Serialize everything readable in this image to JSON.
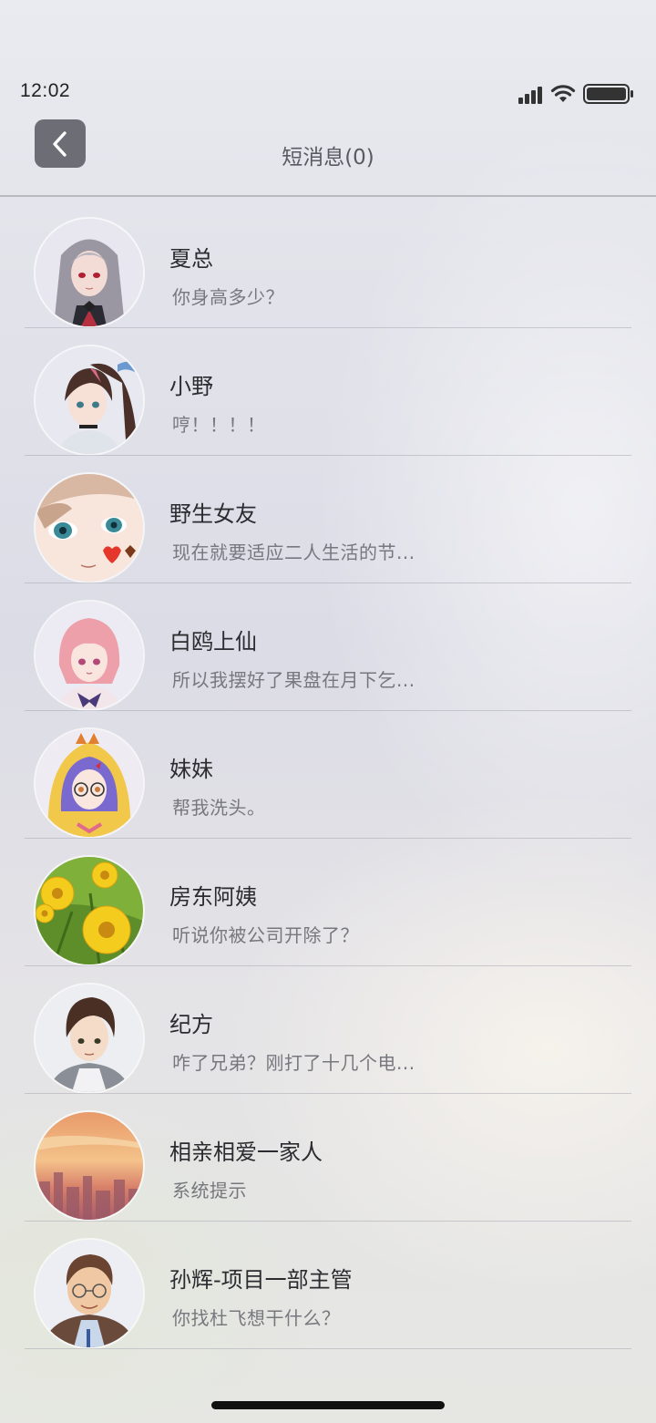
{
  "status_bar": {
    "time": "12:02"
  },
  "header": {
    "title": "短消息(0)",
    "back_icon": "chevron-left-icon"
  },
  "colors": {
    "back_button_bg": "#6d6d75",
    "title_text": "#5a5a62",
    "name_text": "#2b2b30",
    "preview_text": "#77777e"
  },
  "messages": [
    {
      "name": "夏总",
      "preview": "你身高多少？",
      "avatar": "anime-woman-silver-hair-avatar"
    },
    {
      "name": "小野",
      "preview": "哼！！！！",
      "avatar": "anime-girl-ponytail-avatar"
    },
    {
      "name": "野生女友",
      "preview": "现在就要适应二人生活的节...",
      "avatar": "anime-girl-closeup-heart-avatar"
    },
    {
      "name": "白鸥上仙",
      "preview": "所以我摆好了果盘在月下乞...",
      "avatar": "anime-girl-pink-hair-avatar"
    },
    {
      "name": "妹妹",
      "preview": "帮我洗头。",
      "avatar": "anime-girl-glasses-hood-avatar"
    },
    {
      "name": "房东阿姨",
      "preview": "听说你被公司开除了？",
      "avatar": "yellow-flowers-avatar"
    },
    {
      "name": "纪方",
      "preview": "咋了兄弟？刚打了十几个电...",
      "avatar": "anime-man-brown-hair-avatar"
    },
    {
      "name": "相亲相爱一家人",
      "preview": "系统提示",
      "avatar": "sunset-city-avatar"
    },
    {
      "name": "孙辉-项目一部主管",
      "preview": "你找杜飞想干什么？",
      "avatar": "man-glasses-avatar"
    }
  ]
}
